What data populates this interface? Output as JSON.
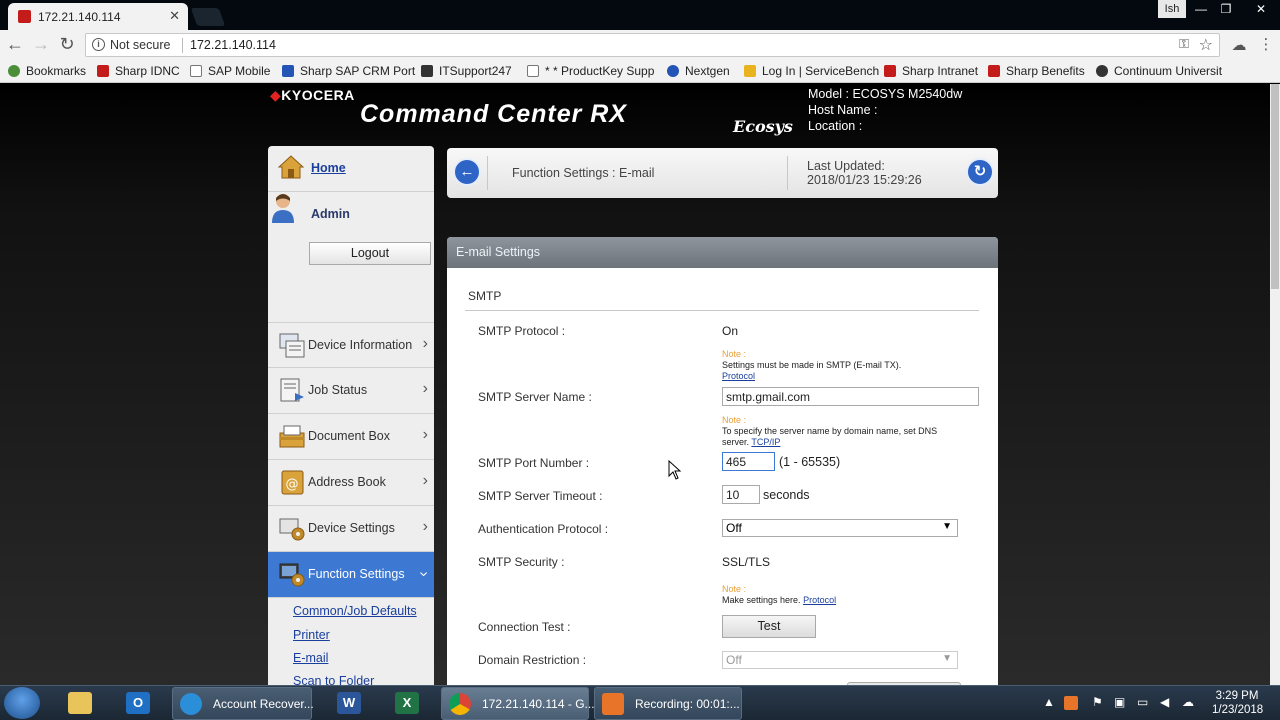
{
  "browser": {
    "tab_title": "172.21.140.114",
    "profile": "Ish",
    "security_label": "Not secure",
    "url": "172.21.140.114",
    "bookmarks": [
      {
        "label": "Bookmarks",
        "color": "#4a8e3a"
      },
      {
        "label": "Sharp IDNC",
        "color": "#c41b1b"
      },
      {
        "label": "SAP Mobile",
        "color": "#ffffff"
      },
      {
        "label": "Sharp SAP CRM Port",
        "color": "#2454b5"
      },
      {
        "label": "ITSupport247",
        "color": "#333333"
      },
      {
        "label": "* * ProductKey Supp",
        "color": "#ffffff"
      },
      {
        "label": "Nextgen",
        "color": "#2454b5"
      },
      {
        "label": "Log In | ServiceBench",
        "color": "#e8b31e"
      },
      {
        "label": "Sharp Intranet",
        "color": "#c41b1b"
      },
      {
        "label": "Sharp Benefits",
        "color": "#c41b1b"
      },
      {
        "label": "Continuum Universit",
        "color": "#333333"
      }
    ]
  },
  "header": {
    "brand": "KYOCERA",
    "product": "Command Center RX",
    "ecosys": "Ecosys",
    "model": "Model : ECOSYS M2540dw",
    "host": "Host Name :",
    "location": "Location :"
  },
  "sidebar": {
    "home": "Home",
    "admin": "Admin",
    "logout": "Logout",
    "items": [
      {
        "label": "Device Information"
      },
      {
        "label": "Job Status"
      },
      {
        "label": "Document Box"
      },
      {
        "label": "Address Book"
      },
      {
        "label": "Device Settings"
      },
      {
        "label": "Function Settings"
      }
    ],
    "subitems": [
      "Common/Job Defaults",
      "Printer",
      "E-mail",
      "Scan to Folder"
    ]
  },
  "breadcrumb": {
    "title": "Function Settings : E-mail",
    "last_updated_label": "Last Updated:",
    "last_updated_value": "2018/01/23 15:29:26"
  },
  "panel": {
    "title": "E-mail Settings",
    "section": "SMTP",
    "smtp_protocol_label": "SMTP Protocol :",
    "smtp_protocol_value": "On",
    "note_label": "Note :",
    "note1_text": "Settings must be made in SMTP (E-mail TX).",
    "note1_link": "Protocol",
    "server_name_label": "SMTP Server Name :",
    "server_name_value": "smtp.gmail.com",
    "note2_text_a": "To specify the server name by domain name, set DNS",
    "note2_text_b": "server.",
    "note2_link": "TCP/IP",
    "port_label": "SMTP Port Number :",
    "port_value": "465",
    "port_range": "(1 - 65535)",
    "timeout_label": "SMTP Server Timeout :",
    "timeout_value": "10",
    "timeout_unit": "seconds",
    "auth_label": "Authentication Protocol :",
    "auth_value": "Off",
    "security_label": "SMTP Security :",
    "security_value": "SSL/TLS",
    "note3_text": "Make settings here.",
    "note3_link": "Protocol",
    "conn_test_label": "Connection Test :",
    "test_button": "Test",
    "domain_label": "Domain Restriction :",
    "domain_value": "Off"
  },
  "taskbar": {
    "tasks": [
      {
        "label": "Account Recover..."
      },
      {
        "label": "172.21.140.114 - G..."
      },
      {
        "label": "Recording:  00:01:..."
      }
    ],
    "time": "3:29 PM",
    "date": "1/23/2018"
  }
}
